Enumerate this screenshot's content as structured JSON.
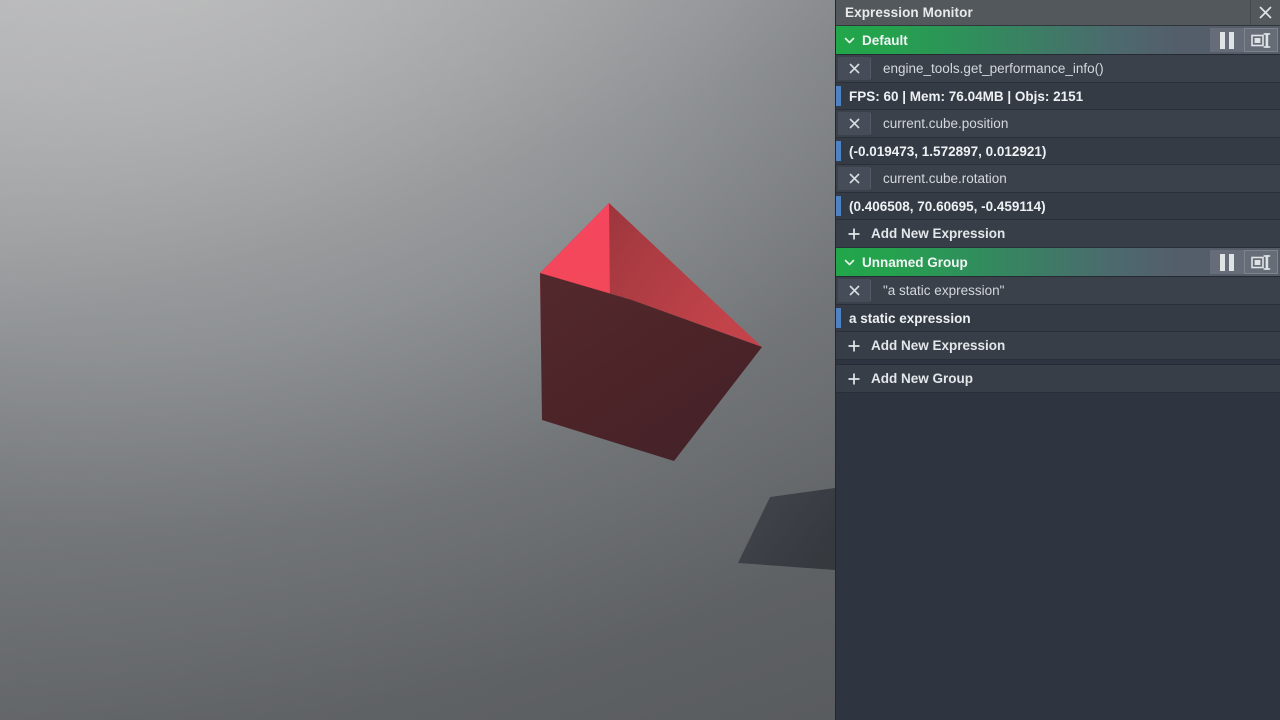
{
  "window": {
    "title": "Expression Monitor",
    "close_icon": "close-icon"
  },
  "colors": {
    "group_header_green": "#21a64a",
    "group_header_gray": "#565d68",
    "panel_background": "#2f3540",
    "result_indicator_blue": "#4d82c4",
    "titlebar_background": "#53585c",
    "cube_left_face": "#f4485c",
    "cube_top_face": "#b03c42",
    "cube_front_face": "#4a2527",
    "shadow": "#3a3e44"
  },
  "groups": [
    {
      "name": "Default",
      "chevron_icon": "chevron-down-icon",
      "pause_icon": "pause-icon",
      "detach_icon": "detach-panel-icon",
      "expressions": [
        {
          "expression": "engine_tools.get_performance_info()",
          "result": "FPS: 60 | Mem: 76.04MB | Objs: 2151",
          "delete_icon": "close-icon"
        },
        {
          "expression": "current.cube.position",
          "result": "(-0.019473, 1.572897, 0.012921)",
          "delete_icon": "close-icon"
        },
        {
          "expression": "current.cube.rotation",
          "result": "(0.406508, 70.60695, -0.459114)",
          "delete_icon": "close-icon"
        }
      ],
      "add_expression_label": "Add New Expression",
      "add_expression_icon": "plus-icon"
    },
    {
      "name": "Unnamed Group",
      "chevron_icon": "chevron-down-icon",
      "pause_icon": "pause-icon",
      "detach_icon": "detach-panel-icon",
      "expressions": [
        {
          "expression": "\"a static expression\"",
          "result": "a static expression",
          "delete_icon": "close-icon"
        }
      ],
      "add_expression_label": "Add New Expression",
      "add_expression_icon": "plus-icon"
    }
  ],
  "add_group": {
    "label": "Add New Group",
    "icon": "plus-icon"
  },
  "viewport": {
    "scene_description": "3D perspective viewport with a rotated red cube casting a shadow on a gray gradient floor"
  }
}
